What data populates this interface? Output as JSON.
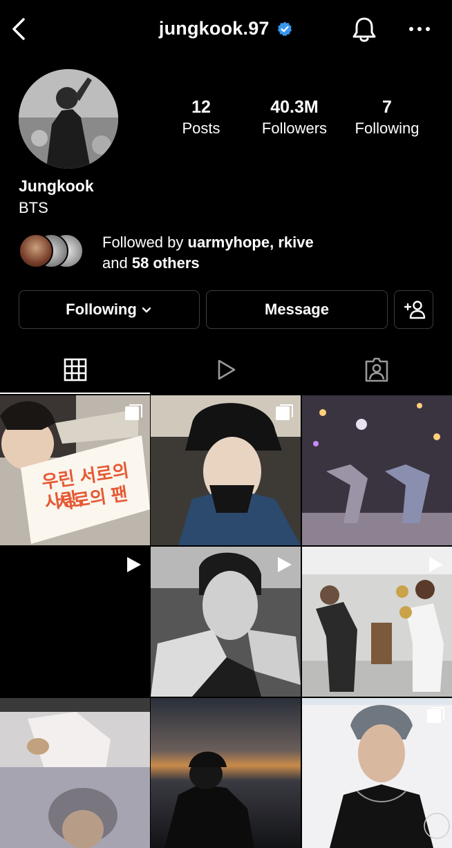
{
  "header": {
    "username": "jungkook.97",
    "back_icon": "chevron-left-icon",
    "verified_icon": "verified-badge-icon",
    "verified_color": "#3897f0",
    "bell_icon": "bell-icon",
    "more_icon": "more-horizontal-icon"
  },
  "profile": {
    "name": "Jungkook",
    "bio": "BTS",
    "stats": [
      {
        "value": "12",
        "label": "Posts"
      },
      {
        "value": "40.3M",
        "label": "Followers"
      },
      {
        "value": "7",
        "label": "Following"
      }
    ],
    "followed_by": {
      "prefix": "Followed by ",
      "names": "uarmyhope, rkive",
      "and": "and ",
      "others": "58 others"
    }
  },
  "actions": {
    "following_label": "Following",
    "message_label": "Message",
    "add_user_icon": "add-user-icon"
  },
  "tabs": [
    {
      "name": "grid",
      "icon": "grid-icon",
      "active": true
    },
    {
      "name": "reels",
      "icon": "play-icon",
      "active": false
    },
    {
      "name": "tagged",
      "icon": "tagged-user-icon",
      "active": false
    }
  ],
  "posts": [
    {
      "type": "carousel",
      "caption_line1": "우린 서로의 사랑,",
      "caption_line2": "서로의 팬"
    },
    {
      "type": "carousel"
    },
    {
      "type": "photo"
    },
    {
      "type": "video"
    },
    {
      "type": "video"
    },
    {
      "type": "video"
    },
    {
      "type": "photo"
    },
    {
      "type": "photo"
    },
    {
      "type": "carousel"
    }
  ]
}
